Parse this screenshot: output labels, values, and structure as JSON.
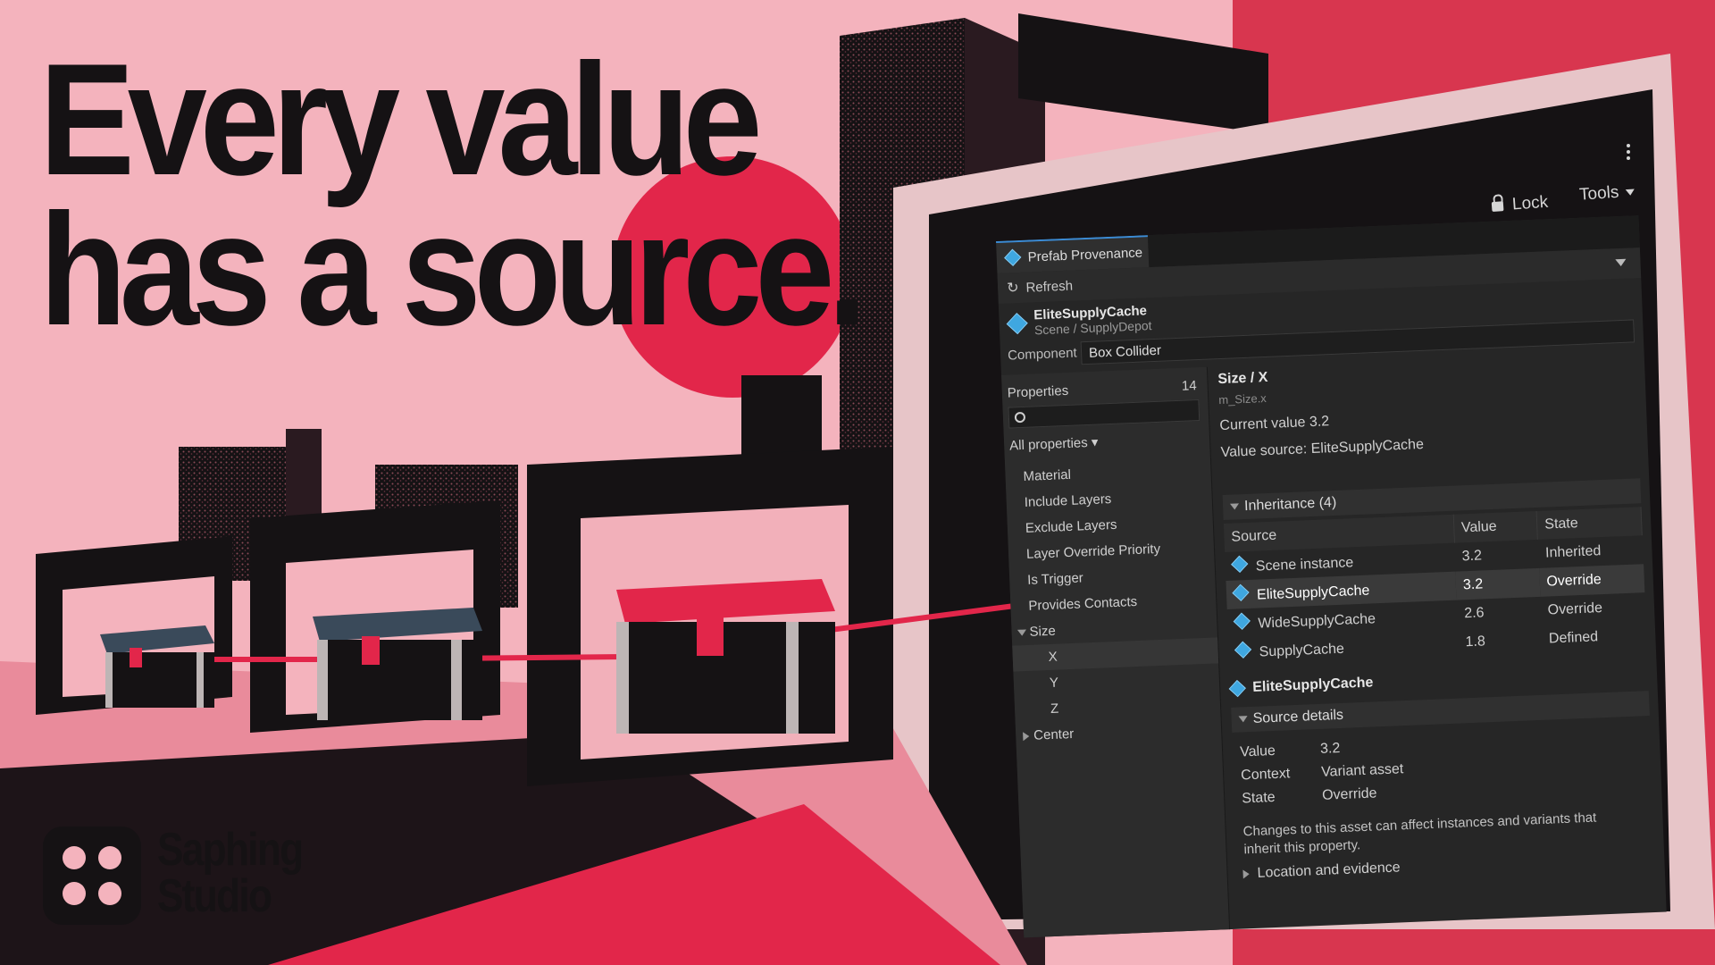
{
  "headline": {
    "line1": "Every value",
    "line2": "has a source."
  },
  "brand": {
    "line1": "Saphing",
    "line2": "Studio"
  },
  "window": {
    "lock_label": "Lock",
    "tools_label": "Tools",
    "tab_label": "Prefab Provenance",
    "refresh_label": "Refresh",
    "object": {
      "name": "EliteSupplyCache",
      "path": "Scene / SupplyDepot"
    },
    "component_label": "Component",
    "component_value": "Box Collider"
  },
  "properties": {
    "header": "Properties",
    "count": "14",
    "filter": "All properties",
    "items": [
      {
        "label": "Material"
      },
      {
        "label": "Include Layers"
      },
      {
        "label": "Exclude Layers"
      },
      {
        "label": "Layer Override Priority"
      },
      {
        "label": "Is Trigger"
      },
      {
        "label": "Provides Contacts"
      },
      {
        "label": "Size"
      },
      {
        "label": "X"
      },
      {
        "label": "Y"
      },
      {
        "label": "Z"
      },
      {
        "label": "Center"
      }
    ]
  },
  "detail": {
    "title": "Size / X",
    "path": "m_Size.x",
    "current_value": "Current value   3.2",
    "value_source": "Value source: EliteSupplyCache",
    "inheritance_header": "Inheritance (4)",
    "columns": [
      "Source",
      "Value",
      "State"
    ],
    "rows": [
      {
        "source": "Scene instance",
        "value": "3.2",
        "state": "Inherited"
      },
      {
        "source": "EliteSupplyCache",
        "value": "3.2",
        "state": "Override"
      },
      {
        "source": "WideSupplyCache",
        "value": "2.6",
        "state": "Override"
      },
      {
        "source": "SupplyCache",
        "value": "1.8",
        "state": "Defined"
      }
    ],
    "selected_source": "EliteSupplyCache",
    "source_details_header": "Source details",
    "details": [
      {
        "key": "Value",
        "value": "3.2"
      },
      {
        "key": "Context",
        "value": "Variant asset"
      },
      {
        "key": "State",
        "value": "Override"
      }
    ],
    "note": "Changes to this asset can affect instances and variants that inherit this property.",
    "location_label": "Location and evidence"
  },
  "colors": {
    "background": "#f4b3bd",
    "accent_red": "#e2264a",
    "ink": "#151214",
    "panel": "#262626",
    "asset_icon": "#3fa7e0"
  }
}
